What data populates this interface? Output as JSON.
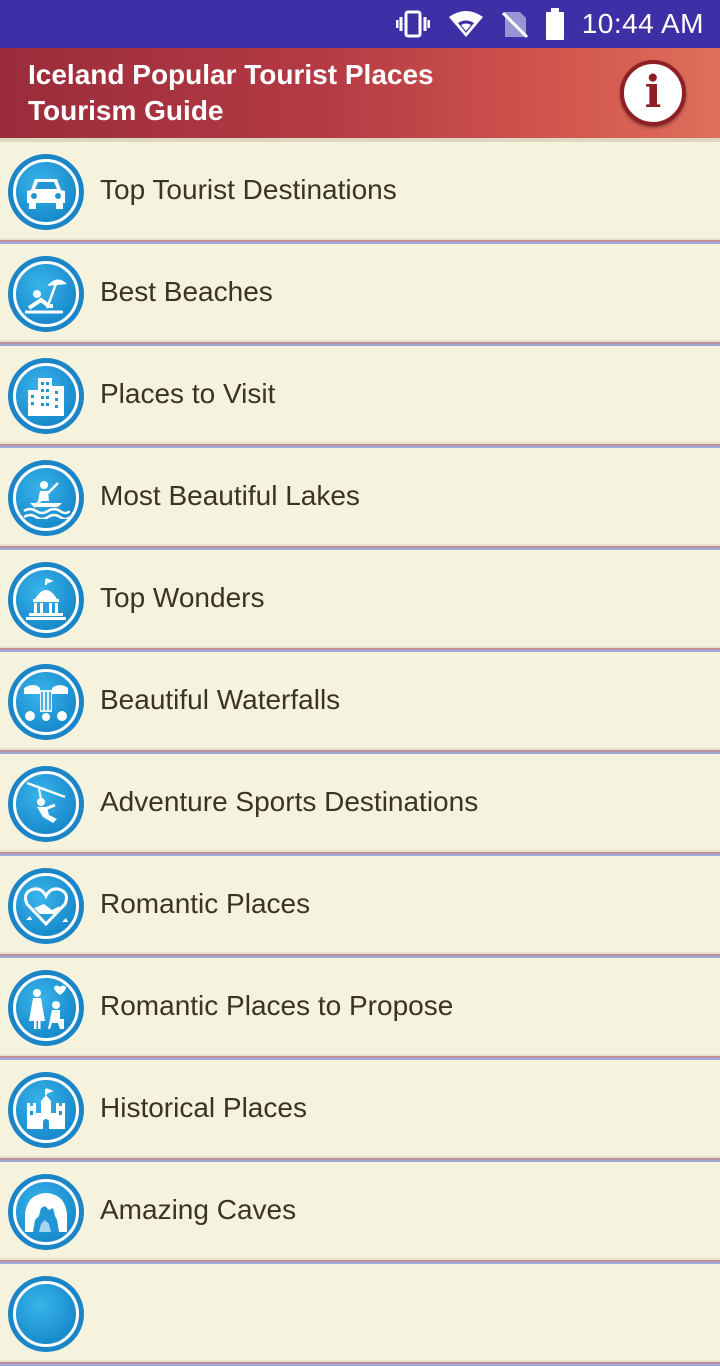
{
  "status_bar": {
    "time": "10:44 AM",
    "icons": [
      "vibrate-icon",
      "wifi-icon",
      "no-sim-icon",
      "battery-icon"
    ]
  },
  "app_bar": {
    "title_line1": "Iceland Popular Tourist Places",
    "title_line2": "Tourism Guide",
    "info_glyph": "i"
  },
  "colors": {
    "status_bar": "#3f2fa6",
    "app_bar_start": "#9a2c3b",
    "app_bar_end": "#e06f5c",
    "list_background": "#f5f2de",
    "icon_blue": "#1b86c7",
    "text": "#3d3226"
  },
  "menu": {
    "items": [
      {
        "label": "Top Tourist Destinations",
        "icon": "car-icon"
      },
      {
        "label": "Best Beaches",
        "icon": "beach-umbrella-icon"
      },
      {
        "label": "Places to Visit",
        "icon": "city-buildings-icon"
      },
      {
        "label": "Most Beautiful Lakes",
        "icon": "kayak-icon"
      },
      {
        "label": "Top Wonders",
        "icon": "capitol-dome-icon"
      },
      {
        "label": "Beautiful Waterfalls",
        "icon": "waterfall-icon"
      },
      {
        "label": "Adventure Sports Destinations",
        "icon": "zipline-icon"
      },
      {
        "label": "Romantic Places",
        "icon": "heart-couple-icon"
      },
      {
        "label": "Romantic Places to Propose",
        "icon": "proposal-icon"
      },
      {
        "label": "Historical Places",
        "icon": "castle-icon"
      },
      {
        "label": "Amazing Caves",
        "icon": "cave-icon"
      }
    ]
  }
}
